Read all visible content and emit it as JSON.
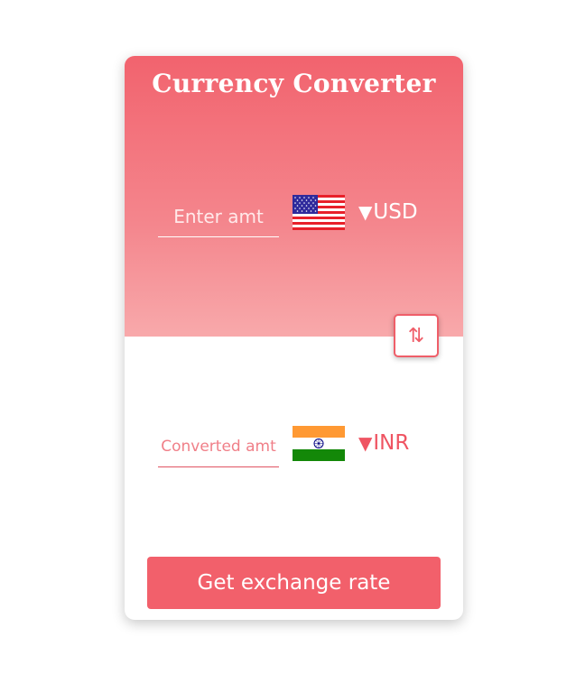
{
  "app": {
    "title": "Currency Converter"
  },
  "from": {
    "placeholder": "Enter amt",
    "value": "",
    "currency": "USD",
    "flag": "us-flag-icon"
  },
  "to": {
    "placeholder": "Converted amt",
    "value": "",
    "currency": "INR",
    "flag": "india-flag-icon"
  },
  "swap": {
    "icon": "swap-vertical-icon",
    "glyph": "⇅"
  },
  "dropdown": {
    "caret": "▼"
  },
  "action": {
    "label": "Get exchange rate"
  },
  "colors": {
    "accent": "#f2606b",
    "gradient_top": "#f2636e",
    "gradient_bottom": "#f8a9ab"
  }
}
